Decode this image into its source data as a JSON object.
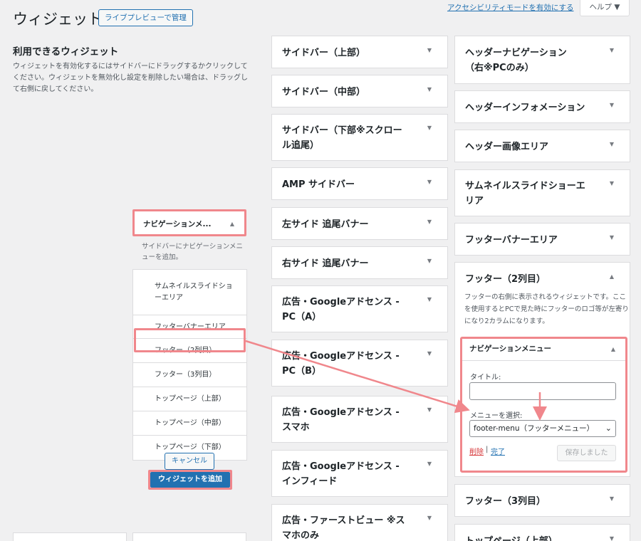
{
  "header": {
    "title": "ウィジェット",
    "preview_button": "ライブプレビューで管理",
    "accessibility_link": "アクセシビリティモードを有効にする",
    "help_tab": "ヘルプ ▼"
  },
  "available": {
    "title": "利用できるウィジェット",
    "description": "ウィジェットを有効化するにはサイドバーにドラッグするかクリックしてください。ウィジェットを無効化し設定を削除したい場合は、ドラッグして右側に戻してください。",
    "nav_widget": {
      "label": "ナビゲーションメ...",
      "description": "サイドバーにナビゲーションメニューを追加。"
    },
    "chooser": [
      {
        "lines": [
          "サムネイルスライドショ",
          "ーエリア"
        ]
      },
      {
        "lines": [
          "フッターバナーエリア"
        ]
      },
      {
        "lines": [
          "フッター（2列目）"
        ]
      },
      {
        "lines": [
          "フッター（3列目）"
        ]
      },
      {
        "lines": [
          "トップページ（上部）"
        ]
      },
      {
        "lines": [
          "トップページ（中部）"
        ]
      },
      {
        "lines": [
          "トップページ（下部）"
        ]
      }
    ],
    "cancel_button": "キャンセル",
    "add_button": "ウィジェットを追加"
  },
  "sidebars_left": [
    {
      "lines": [
        "サイドバー（上部）"
      ]
    },
    {
      "lines": [
        "サイドバー（中部）"
      ]
    },
    {
      "lines": [
        "サイドバー（下部※スクロー",
        "ル追尾）"
      ]
    },
    {
      "lines": [
        "AMP サイドバー"
      ]
    },
    {
      "lines": [
        "左サイド 追尾バナー"
      ]
    },
    {
      "lines": [
        "右サイド 追尾バナー"
      ]
    },
    {
      "lines": [
        "広告・Googleアドセンス -",
        "PC（A）"
      ]
    },
    {
      "lines": [
        "広告・Googleアドセンス -",
        "PC（B）"
      ]
    },
    {
      "lines": [
        "広告・Googleアドセンス -",
        "スマホ"
      ]
    },
    {
      "lines": [
        "広告・Googleアドセンス -",
        "インフィード"
      ]
    },
    {
      "lines": [
        "広告・ファーストビュー ※ス",
        "マホのみ"
      ]
    }
  ],
  "sidebars_right": [
    {
      "lines": [
        "ヘッダーナビゲーション",
        "（右※PCのみ）"
      ]
    },
    {
      "lines": [
        "ヘッダーインフォメーション"
      ]
    },
    {
      "lines": [
        "ヘッダー画像エリア"
      ]
    },
    {
      "lines": [
        "サムネイルスライドショーエ",
        "リア"
      ]
    },
    {
      "lines": [
        "フッターバナーエリア"
      ]
    },
    {
      "lines": [
        "フッター（2列目）"
      ]
    },
    {
      "lines": [
        "フッター（3列目）"
      ]
    },
    {
      "lines": [
        "トップページ（上部）"
      ]
    }
  ],
  "footer2": {
    "description": "フッターの右側に表示されるウィジェットです。ここを使用するとPCで見た時にフッターのロゴ等が左寄りになり2カラムになります。",
    "nav_widget_title": "ナビゲーションメニュー",
    "title_label": "タイトル:",
    "title_value": "",
    "menu_label": "メニューを選択:",
    "menu_selected": "footer-menu（フッターメニュー）",
    "delete_link": "削除",
    "separator": "|",
    "done_link": "完了",
    "saved_button": "保存しました"
  },
  "colors": {
    "accent": "#2271b1",
    "highlight": "#f0878c",
    "delete": "#d63638"
  }
}
